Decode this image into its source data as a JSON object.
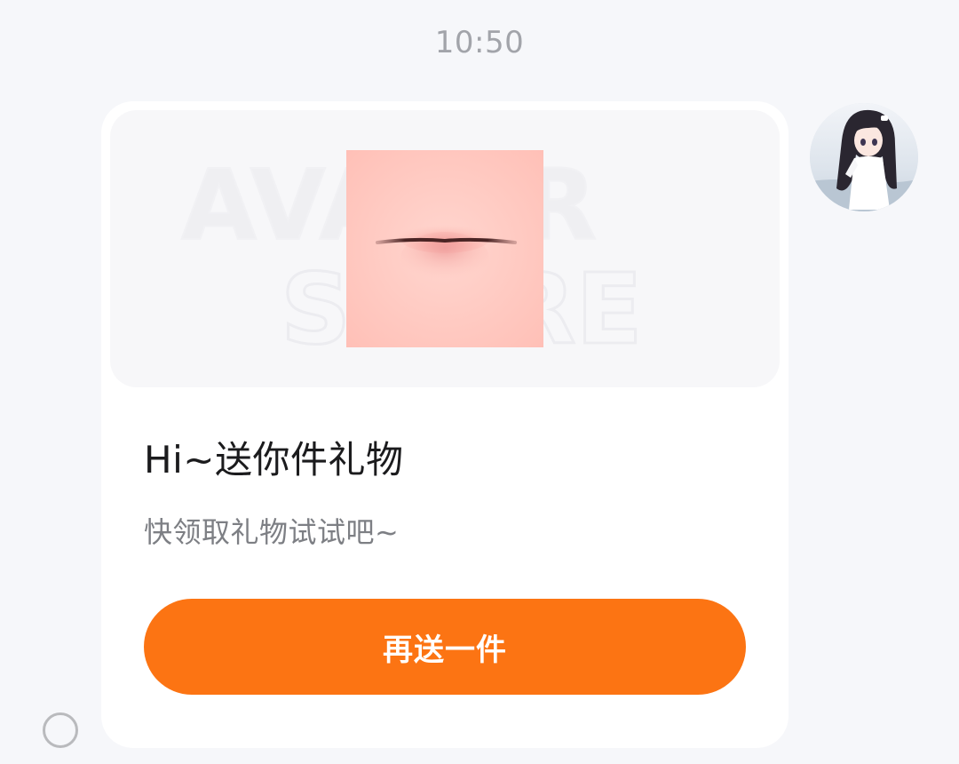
{
  "chat": {
    "timestamp": "10:50"
  },
  "gift_card": {
    "image_icon": "lips-sticker",
    "watermark_text_1": "AVATAR",
    "watermark_text_2": "STORE",
    "title": "Hi~送你件礼物",
    "subtitle": "快领取礼物试试吧~",
    "button_label": "再送一件"
  },
  "sender": {
    "avatar_icon": "anime-girl-avatar"
  },
  "message_status": {
    "icon": "circle-status-icon"
  },
  "colors": {
    "background": "#f6f7fa",
    "card": "#ffffff",
    "button": "#fc7413",
    "title": "#1b1b1d",
    "subtitle": "#7d7f84",
    "timestamp": "#a2a4aa"
  }
}
